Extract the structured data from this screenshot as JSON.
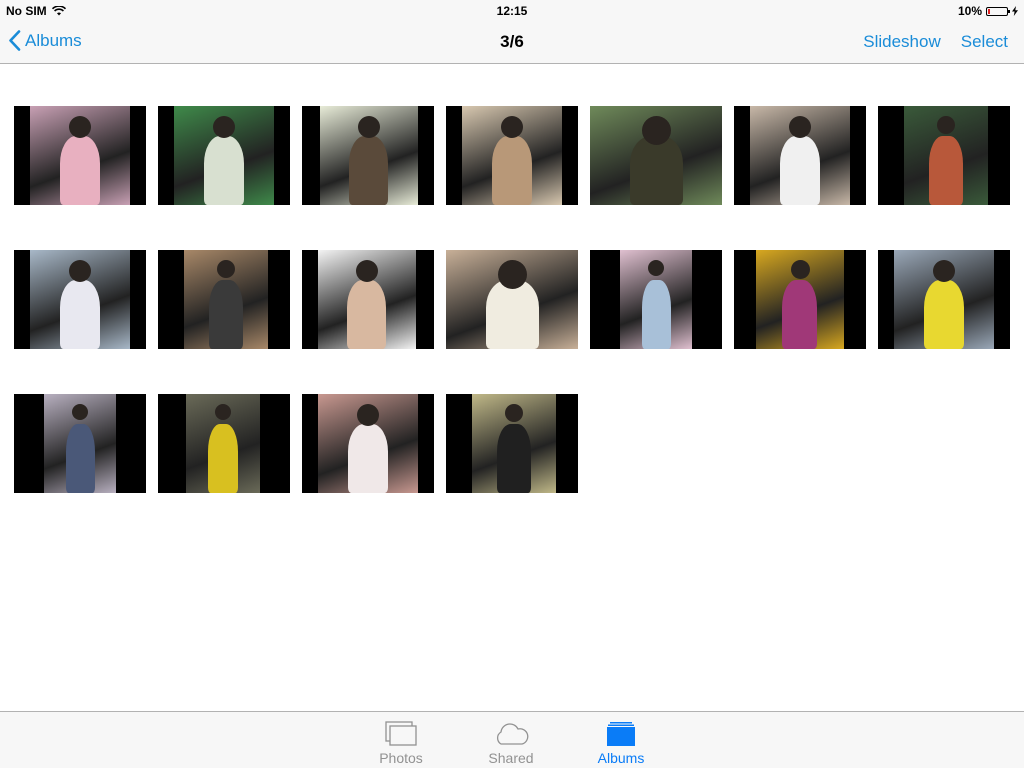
{
  "status_bar": {
    "carrier": "No SIM",
    "time": "12:15",
    "battery": "10%",
    "battery_level": 0.1
  },
  "nav_bar": {
    "back_label": "Albums",
    "title": "3/6",
    "slideshow_label": "Slideshow",
    "select_label": "Select"
  },
  "colors": {
    "accent": "#1a8cd8",
    "tab_active": "#0a7cf7",
    "tab_inactive": "#929292",
    "battery_low": "#e02020"
  },
  "photos": [
    {
      "name": "photo-1",
      "bg": "#c8a0b4",
      "fig": "#e8b0c0"
    },
    {
      "name": "photo-2",
      "bg": "#3f8a4a",
      "fig": "#d8e0d0"
    },
    {
      "name": "photo-3",
      "bg": "#e8ecd8",
      "fig": "#5a4a3a"
    },
    {
      "name": "photo-4",
      "bg": "#d8c8b0",
      "fig": "#b89878"
    },
    {
      "name": "photo-5",
      "bg": "#6f8a5a",
      "fig": "#3a3a2a"
    },
    {
      "name": "photo-6",
      "bg": "#c8b8a8",
      "fig": "#f0f0f0"
    },
    {
      "name": "photo-7",
      "bg": "#3a5a3a",
      "fig": "#b8583a"
    },
    {
      "name": "photo-8",
      "bg": "#a8b8c8",
      "fig": "#e8e8f0"
    },
    {
      "name": "photo-9",
      "bg": "#a88868",
      "fig": "#3a3a3a"
    },
    {
      "name": "photo-10",
      "bg": "#f4f4f4",
      "fig": "#d8b8a0"
    },
    {
      "name": "photo-11",
      "bg": "#c8b098",
      "fig": "#f0ece0"
    },
    {
      "name": "photo-12",
      "bg": "#e0c0d0",
      "fig": "#a8c0d8"
    },
    {
      "name": "photo-13",
      "bg": "#d8a820",
      "fig": "#a03878"
    },
    {
      "name": "photo-14",
      "bg": "#9aa8b8",
      "fig": "#e8d830"
    },
    {
      "name": "photo-15",
      "bg": "#b8b0c0",
      "fig": "#4a5878"
    },
    {
      "name": "photo-16",
      "bg": "#6a6a58",
      "fig": "#d8c020"
    },
    {
      "name": "photo-17",
      "bg": "#c89890",
      "fig": "#f0e8e8"
    },
    {
      "name": "photo-18",
      "bg": "#c0b888",
      "fig": "#202020"
    }
  ],
  "tabs": [
    {
      "name": "photos",
      "label": "Photos",
      "icon": "photos-stack-icon",
      "active": false
    },
    {
      "name": "shared",
      "label": "Shared",
      "icon": "cloud-icon",
      "active": false
    },
    {
      "name": "albums",
      "label": "Albums",
      "icon": "albums-icon",
      "active": true
    }
  ]
}
